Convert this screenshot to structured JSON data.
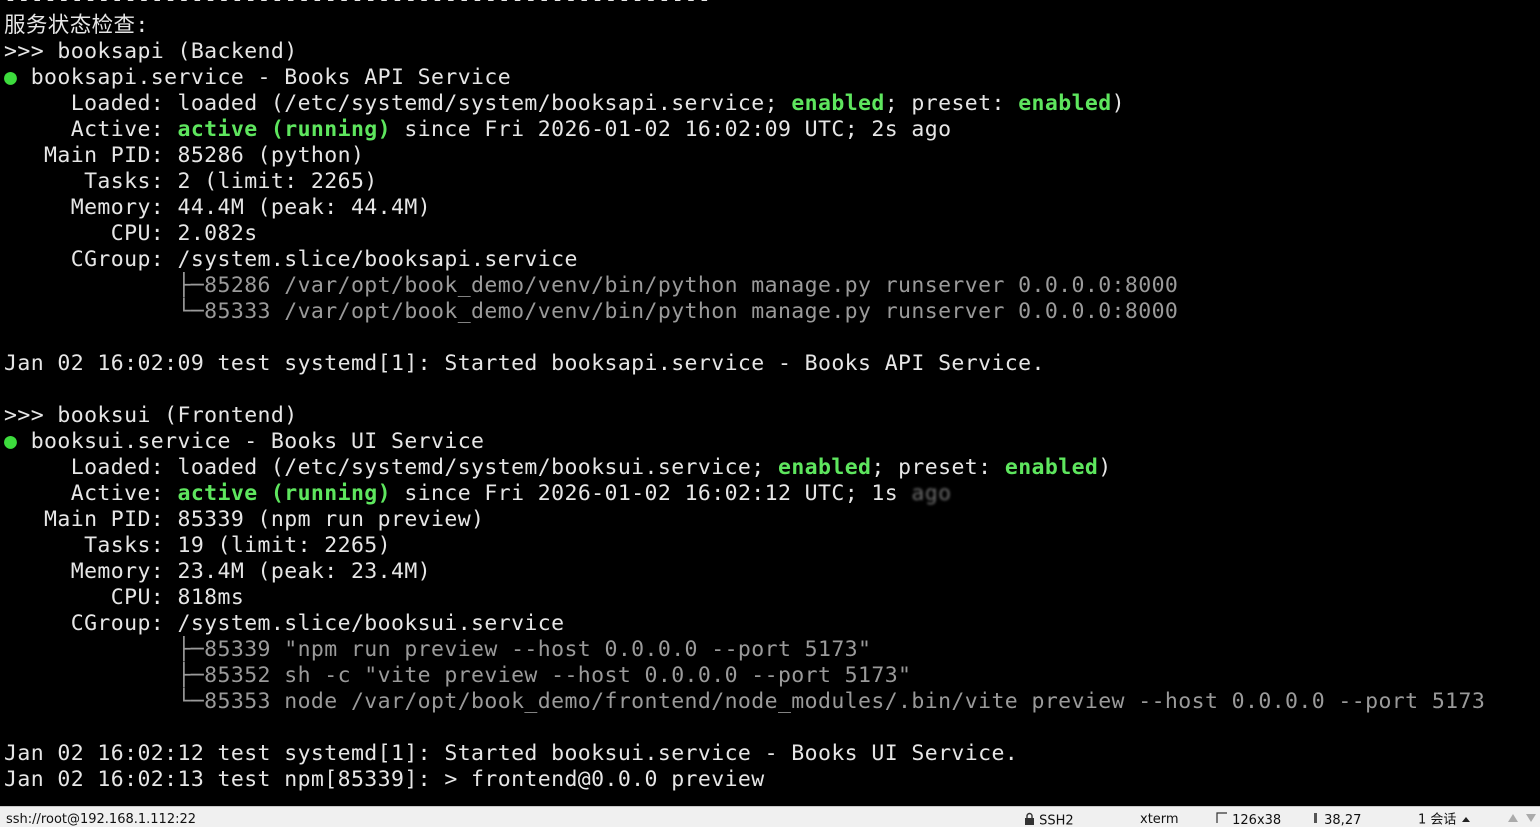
{
  "terminal": {
    "separator": "-----------------------------------------------------",
    "heading": "服务状态检查:",
    "services": [
      {
        "header": ">>> booksapi (Backend)",
        "dot": "●",
        "unit_line": " booksapi.service - Books API Service",
        "loaded_pre": "     Loaded: loaded (/etc/systemd/system/booksapi.service; ",
        "loaded_enabled": "enabled",
        "loaded_mid": "; preset: ",
        "loaded_preset": "enabled",
        "loaded_post": ")",
        "active_label": "     Active: ",
        "active_state": "active (running)",
        "active_since": " since Fri 2026-01-02 16:02:09 UTC; 2s ago",
        "main_pid": "   Main PID: 85286 (python)",
        "tasks": "      Tasks: 2 (limit: 2265)",
        "memory": "     Memory: 44.4M (peak: 44.4M)",
        "cpu": "        CPU: 2.082s",
        "cgroup": "     CGroup: /system.slice/booksapi.service",
        "processes": [
          "             ├─85286 /var/opt/book_demo/venv/bin/python manage.py runserver 0.0.0.0:8000",
          "             └─85333 /var/opt/book_demo/venv/bin/python manage.py runserver 0.0.0.0:8000"
        ],
        "logs": [
          "Jan 02 16:02:09 test systemd[1]: Started booksapi.service - Books API Service."
        ]
      },
      {
        "header": ">>> booksui (Frontend)",
        "dot": "●",
        "unit_line": " booksui.service - Books UI Service",
        "loaded_pre": "     Loaded: loaded (/etc/systemd/system/booksui.service; ",
        "loaded_enabled": "enabled",
        "loaded_mid": "; preset: ",
        "loaded_preset": "enabled",
        "loaded_post": ")",
        "active_label": "     Active: ",
        "active_state": "active (running)",
        "active_since": " since Fri 2026-01-02 16:02:12 UTC; 1s ",
        "active_blurred": "ago",
        "main_pid": "   Main PID: 85339 (npm run preview)",
        "tasks": "      Tasks: 19 (limit: 2265)",
        "memory": "     Memory: 23.4M (peak: 23.4M)",
        "cpu": "        CPU: 818ms",
        "cgroup": "     CGroup: /system.slice/booksui.service",
        "processes": [
          "             ├─85339 \"npm run preview --host 0.0.0.0 --port 5173\"",
          "             ├─85352 sh -c \"vite preview --host 0.0.0.0 --port 5173\"",
          "             └─85353 node /var/opt/book_demo/frontend/node_modules/.bin/vite preview --host 0.0.0.0 --port 5173"
        ],
        "logs": [
          "Jan 02 16:02:12 test systemd[1]: Started booksui.service - Books UI Service.",
          "Jan 02 16:02:13 test npm[85339]: > frontend@0.0.0 preview"
        ]
      }
    ]
  },
  "statusbar": {
    "connection": "ssh://root@192.168.1.112:22",
    "protocol": "SSH2",
    "terminal_type": "xterm",
    "size": "126x38",
    "cursor": "38,27",
    "sessions": "1 会话",
    "icons": [
      "lock-icon",
      "resize-icon",
      "cursor-position-icon",
      "scroll-up-icon",
      "scroll-down-icon"
    ]
  }
}
